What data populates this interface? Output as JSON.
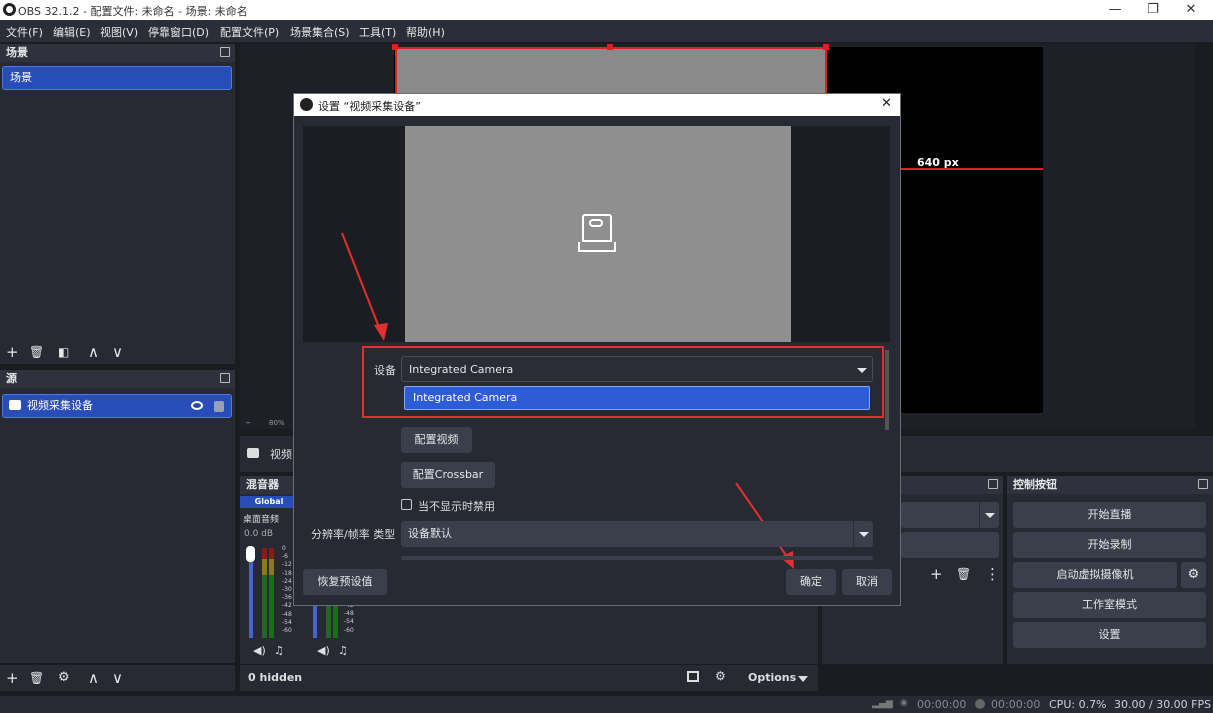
{
  "window": {
    "title": "OBS 32.1.2 - 配置文件: 未命名 - 场景: 未命名",
    "minimize": "—",
    "maximize": "❐",
    "close": "✕"
  },
  "menu": [
    "文件(F)",
    "编辑(E)",
    "视图(V)",
    "停靠窗口(D)",
    "配置文件(P)",
    "场景集合(S)",
    "工具(T)",
    "帮助(H)"
  ],
  "scenes": {
    "header": "场景",
    "items": [
      "场景"
    ],
    "toolbar": [
      "+",
      "🗑",
      "◧",
      "∧",
      "∨"
    ]
  },
  "sources": {
    "header": "源",
    "items": [
      {
        "label": "视频采集设备",
        "visible_icon": "eye-icon",
        "lock_icon": "lock-icon"
      }
    ],
    "context_label": "视频",
    "toolbar": [
      "+",
      "🗑",
      "⚙",
      "∧",
      "∨"
    ]
  },
  "preview": {
    "size_label": "640 px",
    "zoom": "80%"
  },
  "mixer": {
    "header": "混音器",
    "global_badge": "Global",
    "channel_name": "桌面音频",
    "channel_db": "0.0 dB",
    "scale": [
      "0",
      "-6",
      "-12",
      "-18",
      "-24",
      "-30",
      "-36",
      "-42",
      "-48",
      "-54",
      "-60"
    ],
    "scale2": [
      "-42",
      "-48",
      "-54",
      "-60"
    ],
    "hidden_label": "0 hidden",
    "options_label": "Options"
  },
  "controls": {
    "header": "控制按钮",
    "buttons": [
      "开始直播",
      "开始录制",
      "启动虚拟摄像机",
      "工作室模式",
      "设置"
    ]
  },
  "status": {
    "rec_time": "00:00:00",
    "stream_time": "00:00:00",
    "cpu": "CPU: 0.7%",
    "fps": "30.00 / 30.00 FPS"
  },
  "dialog": {
    "title": "设置 “视频采集设备”",
    "device_label": "设备",
    "device_value": "Integrated Camera",
    "device_option": "Integrated Camera",
    "config_video": "配置视频",
    "config_crossbar": "配置Crossbar",
    "disable_when_hidden": "当不显示时禁用",
    "resolution_label": "分辨率/帧率 类型",
    "resolution_value": "设备默认",
    "reset_defaults": "恢复预设值",
    "ok": "确定",
    "cancel": "取消"
  },
  "colors": {
    "accent": "#284cb8",
    "highlight_red": "#e03030"
  }
}
